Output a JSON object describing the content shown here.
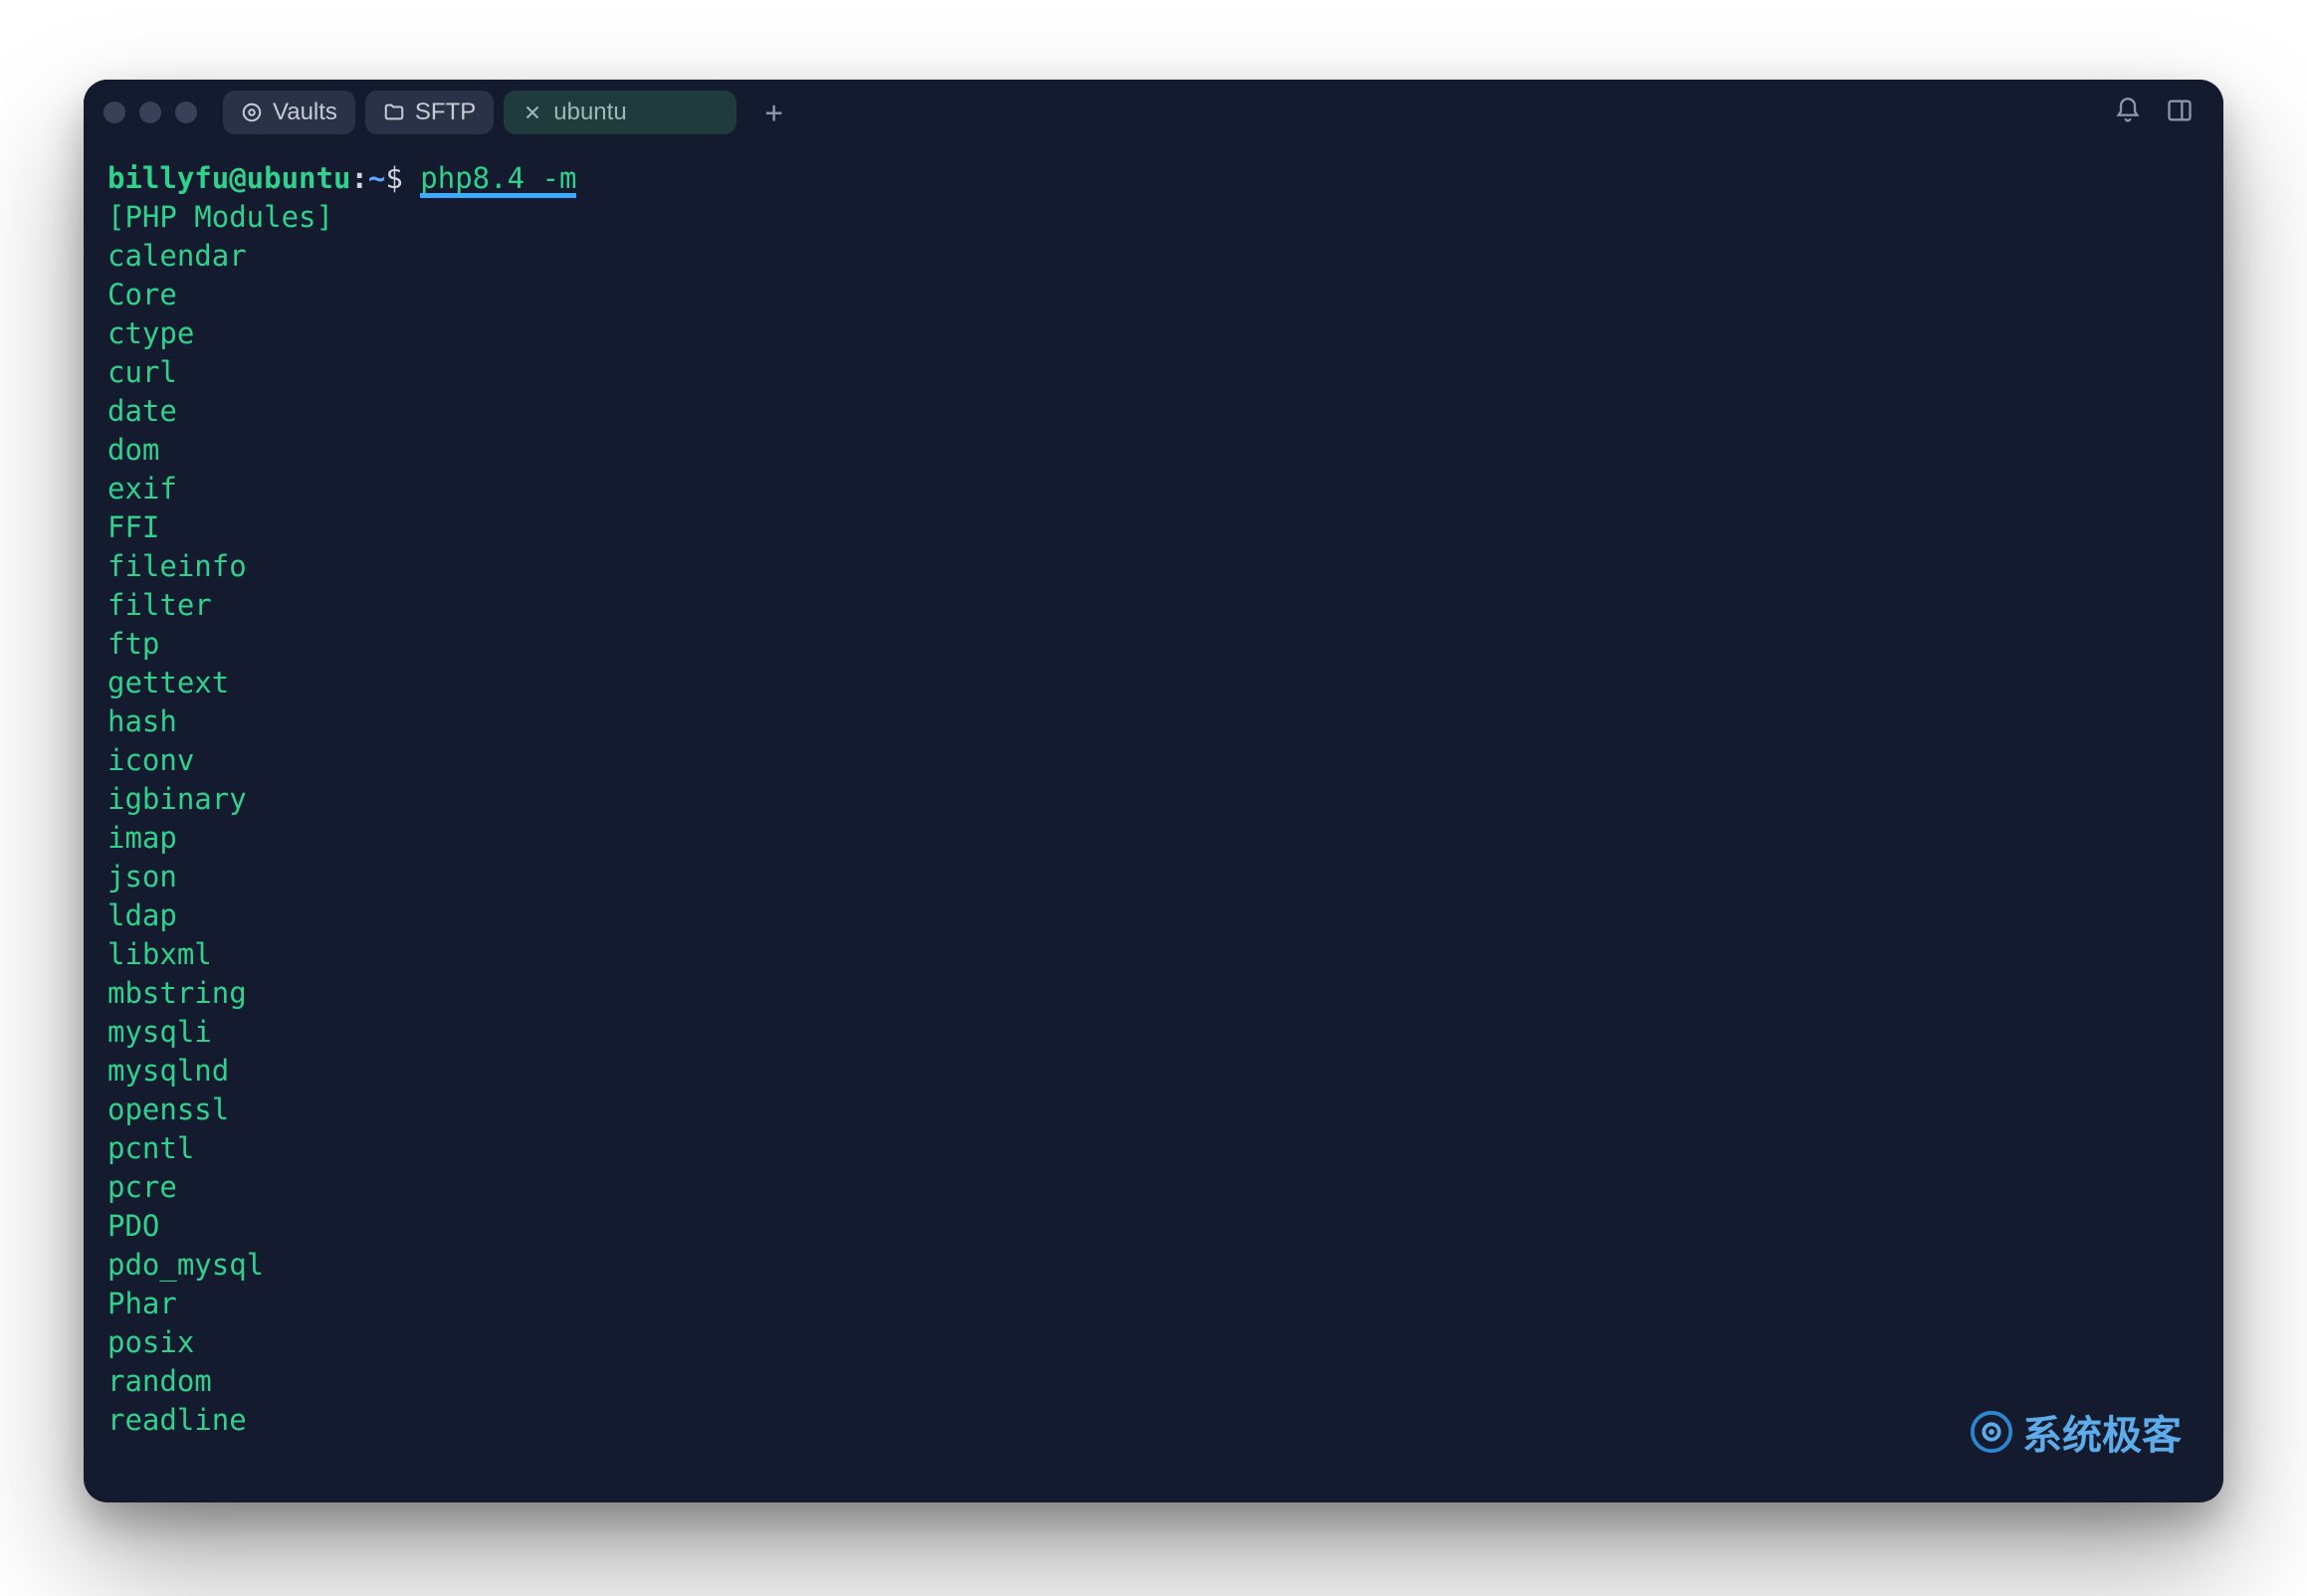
{
  "tabs": {
    "vaults": {
      "label": "Vaults"
    },
    "sftp": {
      "label": "SFTP"
    },
    "active": {
      "label": "ubuntu"
    }
  },
  "prompt": {
    "user_host": "billyfu@ubuntu",
    "colon": ":",
    "path": "~",
    "sep": "$ ",
    "command": "php8.4 -m"
  },
  "output": [
    "[PHP Modules]",
    "calendar",
    "Core",
    "ctype",
    "curl",
    "date",
    "dom",
    "exif",
    "FFI",
    "fileinfo",
    "filter",
    "ftp",
    "gettext",
    "hash",
    "iconv",
    "igbinary",
    "imap",
    "json",
    "ldap",
    "libxml",
    "mbstring",
    "mysqli",
    "mysqlnd",
    "openssl",
    "pcntl",
    "pcre",
    "PDO",
    "pdo_mysql",
    "Phar",
    "posix",
    "random",
    "readline"
  ],
  "watermark": "系统极客"
}
